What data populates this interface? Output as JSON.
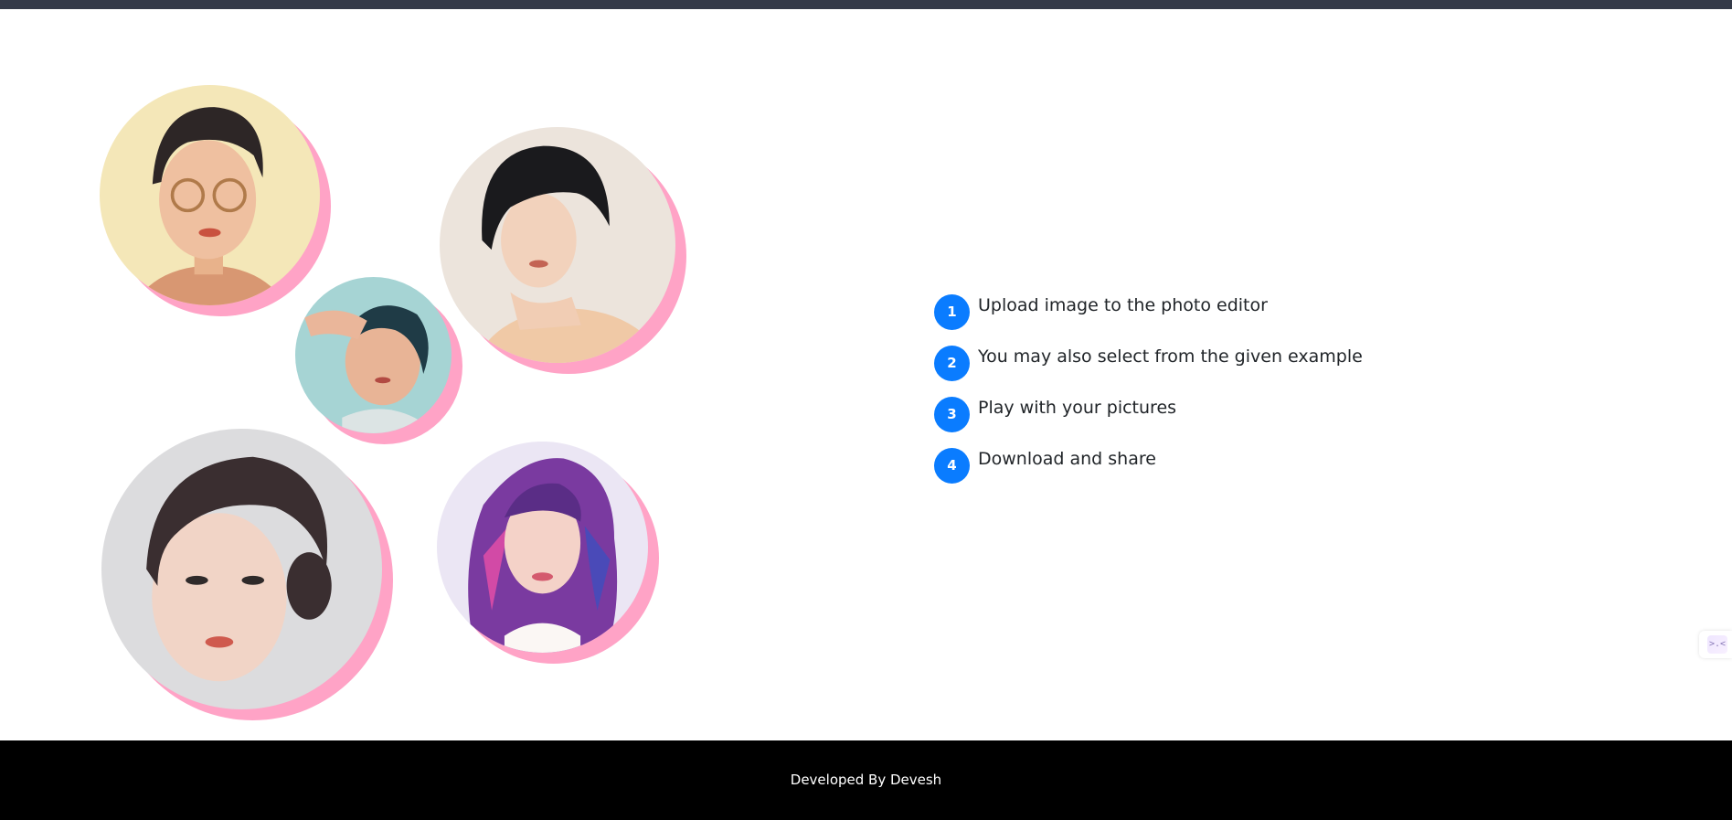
{
  "gallery": {
    "portraits": [
      {
        "name": "portrait-glasses-short-hair"
      },
      {
        "name": "portrait-black-bob"
      },
      {
        "name": "portrait-teal-background"
      },
      {
        "name": "portrait-updo-hair"
      },
      {
        "name": "portrait-purple-hair"
      }
    ]
  },
  "steps": [
    {
      "number": "1",
      "text": "Upload image to the photo editor"
    },
    {
      "number": "2",
      "text": "You may also select from the given example"
    },
    {
      "number": "3",
      "text": "Play with your pictures"
    },
    {
      "number": "4",
      "text": "Download and share"
    }
  ],
  "widget": {
    "icon": "chat-widget-icon",
    "glyph": ">.<"
  },
  "footer": {
    "credit": "Developed By Devesh"
  },
  "colors": {
    "topbar": "#343a48",
    "accent": "#0a7cff",
    "shadow_pink": "#ffa3c6",
    "footer_bg": "#000000",
    "text": "#212529"
  }
}
